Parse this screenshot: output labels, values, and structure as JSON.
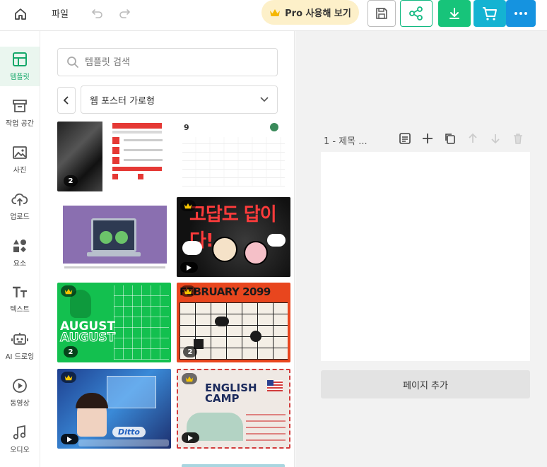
{
  "topbar": {
    "file_label": "파일",
    "pro_label": "Pro 사용해 보기"
  },
  "sidebar": {
    "items": [
      {
        "label": "템플릿",
        "icon": "template-icon",
        "active": true
      },
      {
        "label": "작업 공간",
        "icon": "archive-icon"
      },
      {
        "label": "사진",
        "icon": "image-icon"
      },
      {
        "label": "업로드",
        "icon": "upload-cloud-icon"
      },
      {
        "label": "요소",
        "icon": "elements-icon"
      },
      {
        "label": "텍스트",
        "icon": "text-icon"
      },
      {
        "label": "AI 드로잉",
        "icon": "robot-icon"
      },
      {
        "label": "동영상",
        "icon": "play-circle-icon"
      },
      {
        "label": "오디오",
        "icon": "music-note-icon"
      }
    ]
  },
  "panel": {
    "search_placeholder": "템플릿 검색",
    "category": "웹 포스터 가로형",
    "templates": [
      {
        "count": "2",
        "video": false,
        "premium": false
      },
      {
        "count": "",
        "video": false,
        "premium": false
      },
      {
        "count": "",
        "video": false,
        "premium": false
      },
      {
        "count": "",
        "video": true,
        "premium": true,
        "text": "고답도 답이다!"
      },
      {
        "count": "2",
        "video": false,
        "premium": true,
        "text": "AUGUST"
      },
      {
        "count": "2",
        "video": false,
        "premium": true,
        "text": "FEBRUARY 2099"
      },
      {
        "count": "",
        "video": true,
        "premium": true,
        "text": "Ditto"
      },
      {
        "count": "",
        "video": true,
        "premium": true,
        "text": "ENGLISH CAMP"
      }
    ]
  },
  "canvas": {
    "page_title": "1 - 제목 ...",
    "add_page_label": "페이지 추가"
  },
  "colors": {
    "accent": "#17c47a",
    "share": "#11b981",
    "cart": "#14b3d2",
    "more": "#1593e0",
    "pro_bg": "#fdf0c9"
  }
}
